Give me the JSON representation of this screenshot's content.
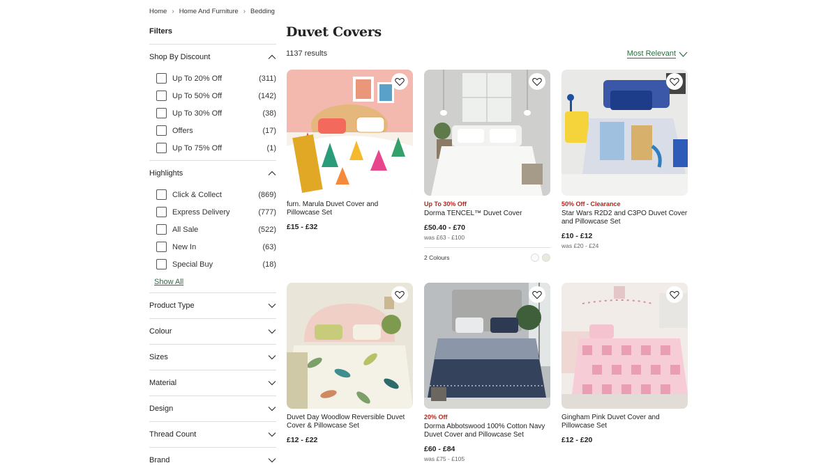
{
  "breadcrumb": [
    "Home",
    "Home And Furniture",
    "Bedding"
  ],
  "sidebar": {
    "title": "Filters",
    "discount": {
      "title": "Shop By Discount",
      "options": [
        {
          "label": "Up To 20% Off",
          "count": "(311)"
        },
        {
          "label": "Up To 50% Off",
          "count": "(142)"
        },
        {
          "label": "Up To 30% Off",
          "count": "(38)"
        },
        {
          "label": "Offers",
          "count": "(17)"
        },
        {
          "label": "Up To 75% Off",
          "count": "(1)"
        }
      ]
    },
    "highlights": {
      "title": "Highlights",
      "options": [
        {
          "label": "Click & Collect",
          "count": "(869)"
        },
        {
          "label": "Express Delivery",
          "count": "(777)"
        },
        {
          "label": "All Sale",
          "count": "(522)"
        },
        {
          "label": "New In",
          "count": "(63)"
        },
        {
          "label": "Special Buy",
          "count": "(18)"
        }
      ],
      "show_all": "Show All"
    },
    "collapsed": [
      "Product Type",
      "Colour",
      "Sizes",
      "Material",
      "Design",
      "Thread Count",
      "Brand"
    ]
  },
  "main": {
    "title": "Duvet Covers",
    "results": "1137 results",
    "sort_label": "Most Relevant"
  },
  "products": [
    {
      "promo": "",
      "name": "furn. Marula Duvet Cover and Pillowcase Set",
      "price": "£15 - £32",
      "was": ""
    },
    {
      "promo": "Up To 30% Off",
      "name": "Dorma TENCEL™ Duvet Cover",
      "price": "£50.40 - £70",
      "was": "was £63 - £100",
      "colours": "2 Colours"
    },
    {
      "promo": "50% Off - Clearance",
      "name": "Star Wars R2D2 and C3PO Duvet Cover and Pillowcase Set",
      "price": "£10 - £12",
      "was": "was £20 - £24"
    },
    {
      "promo": "",
      "name": "Duvet Day Woodlow Reversible Duvet Cover & Pillowcase Set",
      "price": "£12 - £22",
      "was": ""
    },
    {
      "promo": "20% Off",
      "name": "Dorma Abbotswood 100% Cotton Navy Duvet Cover and Pillowcase Set",
      "price": "£60 - £84",
      "was": "was £75 - £105"
    },
    {
      "promo": "",
      "name": "Gingham Pink Duvet Cover and Pillowcase Set",
      "price": "£12 - £20",
      "was": ""
    }
  ],
  "colors": {
    "accent_green": "#2a6e3f",
    "promo_red": "#b3261e"
  }
}
